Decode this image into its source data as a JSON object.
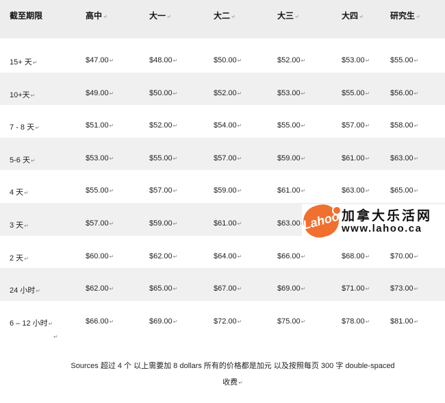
{
  "table": {
    "headers": [
      "截至期限",
      "高中",
      "大一",
      "大二",
      "大三",
      "大四",
      "研究生"
    ],
    "rows": [
      {
        "deadline": "15+ 天",
        "cells": [
          "$47.00",
          "$48.00",
          "$50.00",
          "$52.00",
          "$53.00",
          "$55.00"
        ]
      },
      {
        "deadline": "10+天",
        "cells": [
          "$49.00",
          "$50.00",
          "$52.00",
          "$53.00",
          "$55.00",
          "$56.00"
        ]
      },
      {
        "deadline": "7 - 8 天",
        "cells": [
          "$51.00",
          "$52.00",
          "$54.00",
          "$55.00",
          "$57.00",
          "$58.00"
        ]
      },
      {
        "deadline": "5-6 天",
        "cells": [
          "$53.00",
          "$55.00",
          "$57.00",
          "$59.00",
          "$61.00",
          "$63.00"
        ]
      },
      {
        "deadline": "4 天",
        "cells": [
          "$55.00",
          "$57.00",
          "$59.00",
          "$61.00",
          "$63.00",
          "$65.00"
        ]
      },
      {
        "deadline": "3 天",
        "cells": [
          "$57.00",
          "$59.00",
          "$61.00",
          "$63.00",
          "",
          ""
        ]
      },
      {
        "deadline": "2 天",
        "cells": [
          "$60.00",
          "$62.00",
          "$64.00",
          "$66.00",
          "$68.00",
          "$70.00"
        ]
      },
      {
        "deadline": "24 小时",
        "cells": [
          "$62.00",
          "$65.00",
          "$67.00",
          "$69.00",
          "$71.00",
          "$73.00"
        ]
      },
      {
        "deadline": "6 – 12 小时",
        "cells": [
          "$66.00",
          "$69.00",
          "$72.00",
          "$75.00",
          "$78.00",
          "$81.00"
        ]
      }
    ]
  },
  "footer": {
    "line1": "Sources 超过 4 个 以上需要加 8 dollars  所有的价格都是加元 以及按照每页 300 字 double-spaced",
    "line2": "收费"
  },
  "watermark": {
    "logo_text": "Lahoo",
    "title": "加拿大乐活网",
    "url": "www.lahoo.ca",
    "brand_color": "#f07030"
  },
  "paragraph_mark": "↵"
}
